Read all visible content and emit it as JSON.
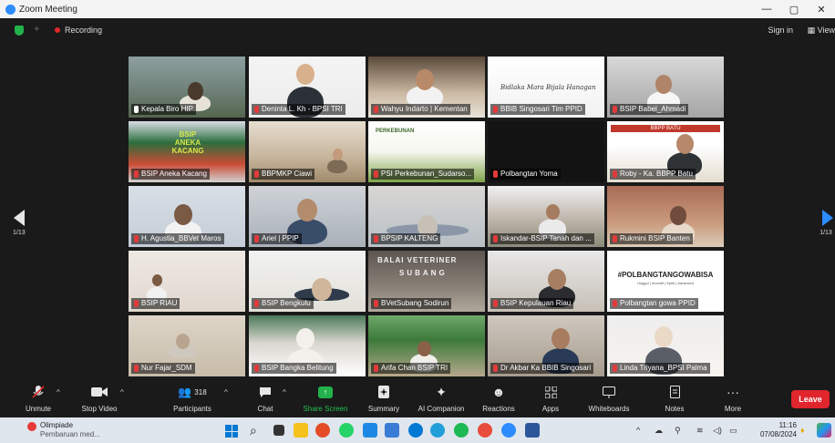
{
  "window": {
    "title": "Zoom Meeting",
    "controls": {
      "minimize": "—",
      "maximize": "▢",
      "close": "✕"
    }
  },
  "topbar": {
    "recording": "Recording",
    "sign_in": "Sign in",
    "view": "View"
  },
  "pager": {
    "left": "1/13",
    "right": "1/13"
  },
  "participants": [
    {
      "name": "Kepala Biro HIP",
      "muted": false
    },
    {
      "name": "Deninta L. Kh - BPSI TRI",
      "muted": true
    },
    {
      "name": "Wahyu Indarto | Kementan",
      "muted": true
    },
    {
      "name": "BBIB Singosari Tim PPID",
      "muted": true
    },
    {
      "name": "BSIP Babel_Ahmadi",
      "muted": true
    },
    {
      "name": "BSIP Aneka Kacang",
      "muted": true
    },
    {
      "name": "BBPMKP Ciawi",
      "muted": true
    },
    {
      "name": "PSI Perkebunan_Sudarso...",
      "muted": true
    },
    {
      "name": "Polbangtan Yoma",
      "muted": true
    },
    {
      "name": "Roby - Ka. BBPP Batu",
      "muted": true
    },
    {
      "name": "H. Agustia_BBVet Maros",
      "muted": true
    },
    {
      "name": "Ariel | PPIP",
      "muted": true
    },
    {
      "name": "BPSIP KALTENG",
      "muted": true
    },
    {
      "name": "Iskandar-BSIP Tanah dan ...",
      "muted": true
    },
    {
      "name": "Rukmini BSIP Banten",
      "muted": true
    },
    {
      "name": "BSIP RIAU",
      "muted": true
    },
    {
      "name": "BSIP Bengkulu",
      "muted": true
    },
    {
      "name": "BVetSubang Sodirun",
      "muted": true
    },
    {
      "name": "BSIP Kepulauan Riau",
      "muted": true
    },
    {
      "name": "Polbangtan gowa PPID",
      "muted": true
    },
    {
      "name": "Nur Fajar_SDM",
      "muted": true
    },
    {
      "name": "BSIP Bangka Belitung",
      "muted": true
    },
    {
      "name": "Arifa Chan BSIP TRI",
      "muted": true
    },
    {
      "name": "Dr Akbar Ka BBIB Singosari",
      "muted": true
    },
    {
      "name": "Linda Triyana_BPSI Palma",
      "muted": true
    }
  ],
  "tile_overlays": {
    "bbib": "Bidlaka Mara Bijala Hanagan",
    "ppsi": "PERKEBUNAN",
    "balai": "BALAI VETERINER",
    "subang": "SUBANG",
    "polbangtan": "#POLBANGTANGOWABISA",
    "polbangtan_sub": "Unggul | Inovatif | Spirit | Advanced",
    "bsip_sign": "BSIP ANEKA KACANG",
    "batu_banner": "BBPP BATU"
  },
  "toolbar": {
    "unmute": "Unmute",
    "stop_video": "Stop Video",
    "participants": "Participants",
    "participants_count": "318",
    "chat": "Chat",
    "share_screen": "Share Screen",
    "summary": "Summary",
    "ai_companion": "AI Companion",
    "reactions": "Reactions",
    "apps": "Apps",
    "whiteboards": "Whiteboards",
    "notes": "Notes",
    "more": "More",
    "leave": "Leave"
  },
  "taskbar": {
    "notif_title": "Olimpiade",
    "notif_sub": "Pembaruan med...",
    "time": "11:16",
    "date": "07/08/2024"
  },
  "colors": {
    "active_speaker": "#b8d640",
    "share_green": "#22b14c",
    "leave_red": "#e0252d",
    "zoom_blue": "#2d8cff"
  }
}
